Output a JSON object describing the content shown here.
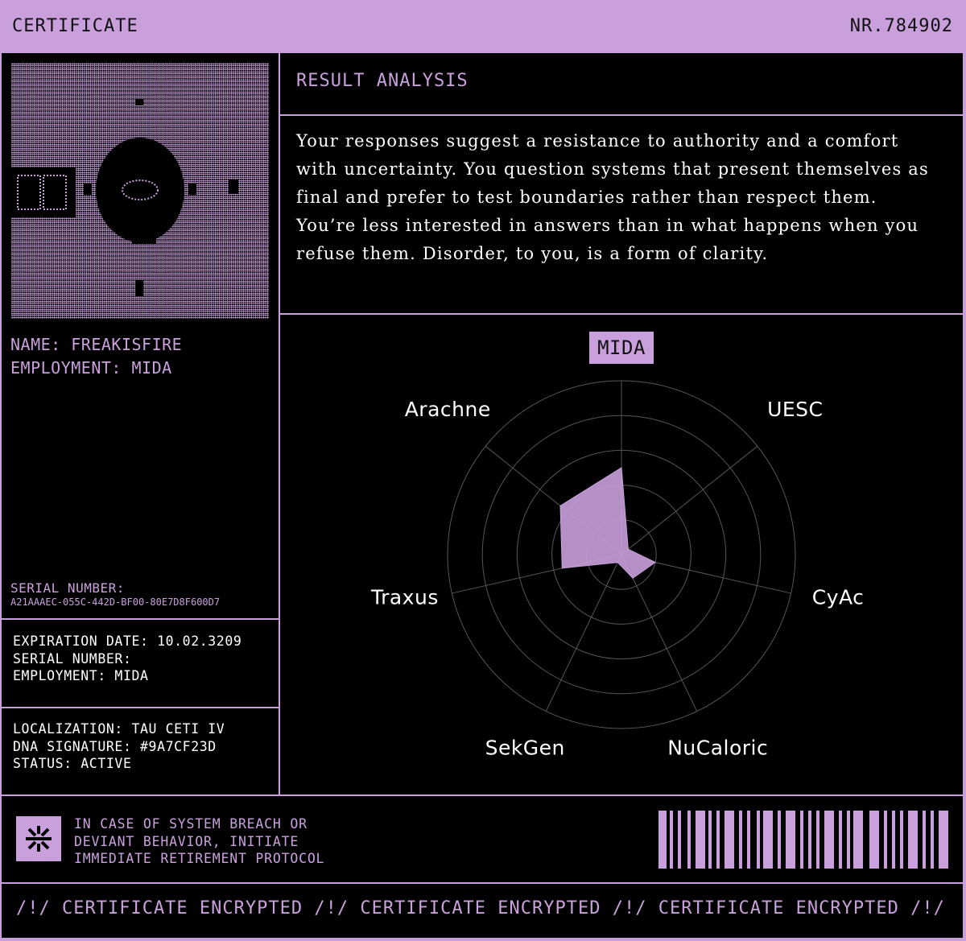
{
  "header": {
    "title": "CERTIFICATE",
    "number": "NR.784902"
  },
  "profile": {
    "name_line": "NAME: FREAKISFIRE",
    "employment_line": "EMPLOYMENT: MIDA",
    "serial_label": "SERIAL NUMBER:",
    "serial_value": "A21AAAEC-055C-442D-BF00-80E7D8F600D7"
  },
  "details_1": "EXPIRATION DATE: 10.02.3209\nSERIAL NUMBER:\nEMPLOYMENT: MIDA",
  "details_2": "LOCALIZATION: TAU CETI IV\nDNA SIGNATURE: #9A7CF23D\nSTATUS: ACTIVE",
  "result": {
    "title": "RESULT ANALYSIS",
    "text": "Your responses suggest a resistance to authority and a comfort with uncertainty. You question systems that present themselves as final and prefer to test boundaries rather than respect them. You’re less interested in answers than in what happens when you refuse them. Disorder, to you, is a form of clarity."
  },
  "chart_data": {
    "type": "radar",
    "categories": [
      "MIDA",
      "UESC",
      "CyAc",
      "NuCaloric",
      "SekGen",
      "Traxus",
      "Arachne"
    ],
    "highlighted_category": "MIDA",
    "rings": 5,
    "values": [
      0.5,
      0.05,
      0.2,
      0.15,
      0.05,
      0.35,
      0.45
    ],
    "fill_color": "#C9A0DC"
  },
  "footer": {
    "warning": "IN CASE OF SYSTEM BREACH OR\nDEVIANT BEHAVIOR, INITIATE\nIMMEDIATE RETIREMENT PROTOCOL",
    "ticker": "/!/ CERTIFICATE ENCRYPTED /!/ CERTIFICATE ENCRYPTED /!/ CERTIFICATE ENCRYPTED /!/ CE"
  },
  "colors": {
    "accent": "#C9A0DC",
    "background": "#000000",
    "text": "#FFFFFF"
  }
}
